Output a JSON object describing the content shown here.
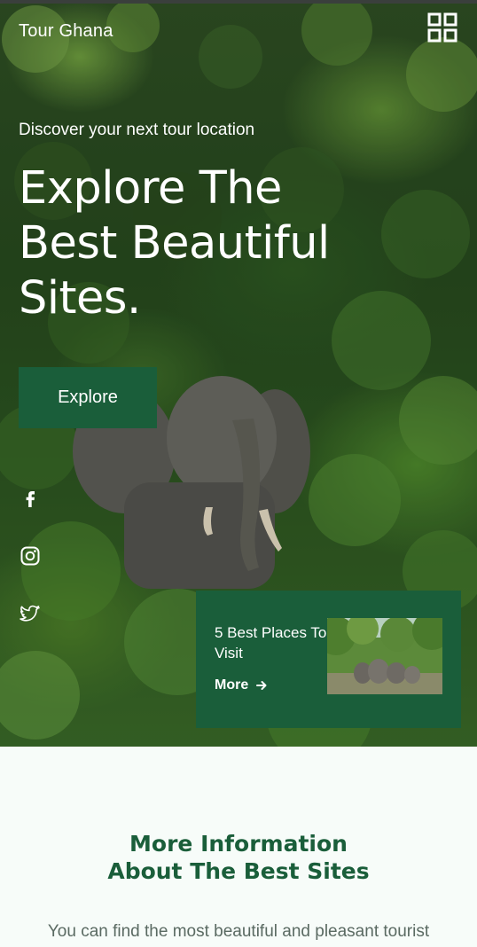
{
  "app": {
    "brand": "Tour Ghana"
  },
  "hero": {
    "subtitle": "Discover your next tour location",
    "headline_line1": "Explore The",
    "headline_line2": "Best Beautiful",
    "headline_line3": "Sites.",
    "cta_label": "Explore"
  },
  "social": {
    "items": [
      {
        "name": "facebook-icon"
      },
      {
        "name": "instagram-icon"
      },
      {
        "name": "twitter-icon"
      }
    ]
  },
  "card": {
    "title": "5 Best Places To Visit",
    "more_label": "More",
    "more_icon": "arrow-right-icon"
  },
  "info": {
    "title_line1": "More Information",
    "title_line2": "About The Best Sites",
    "text": "You can find the most beautiful and pleasant tourist"
  },
  "colors": {
    "accent": "#1a5e3a",
    "page_bg": "#f7fcf9",
    "text_muted": "#5a6a62"
  }
}
